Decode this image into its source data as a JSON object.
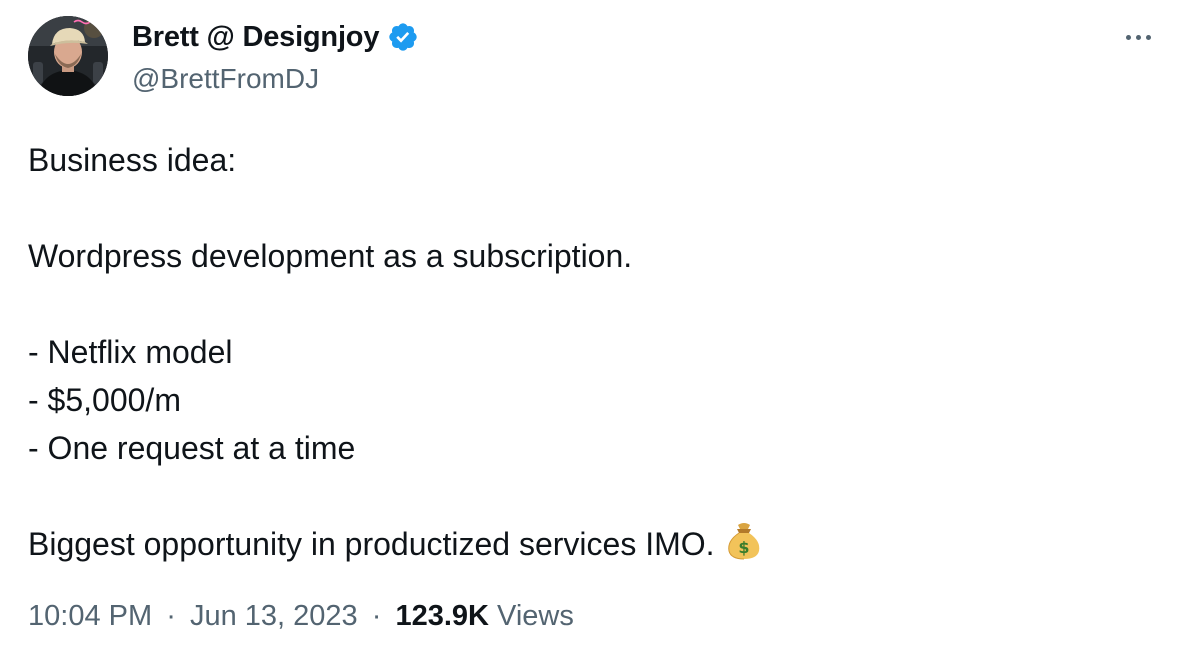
{
  "author": {
    "display_name": "Brett @ Designjoy",
    "handle": "@BrettFromDJ",
    "verified": true
  },
  "tweet": {
    "line1": "Business idea:",
    "line2": "Wordpress development as a subscription.",
    "bullets": [
      "- Netflix model",
      "- $5,000/m",
      "- One request at a time"
    ],
    "closing": "Biggest opportunity in productized services IMO.",
    "closing_emoji": "money-bag-icon"
  },
  "meta": {
    "time": "10:04 PM",
    "date": "Jun 13, 2023",
    "separator": "·",
    "views_count": "123.9K",
    "views_label": "Views"
  },
  "colors": {
    "text": "#0f1419",
    "secondary": "#536471",
    "verified_blue": "#1d9bf0"
  }
}
